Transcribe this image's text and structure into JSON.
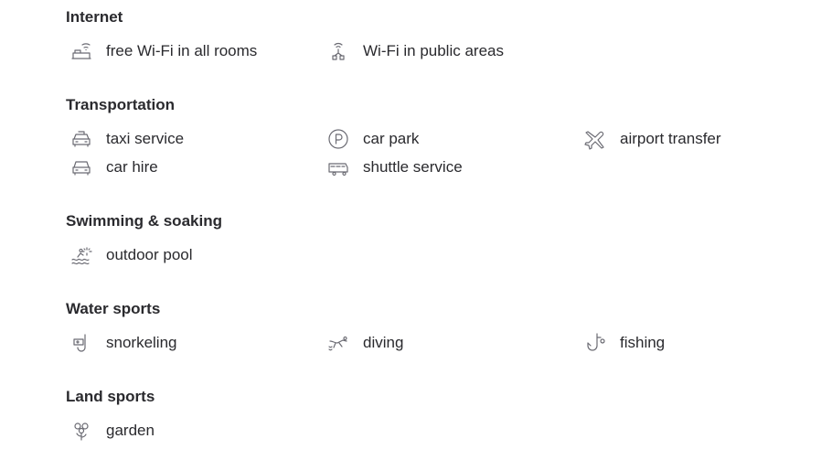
{
  "sections": [
    {
      "title": "Internet",
      "items": [
        {
          "label": "free Wi-Fi in all rooms",
          "icon": "wifi-bed-icon"
        },
        {
          "label": "Wi-Fi in public areas",
          "icon": "wifi-router-icon"
        }
      ]
    },
    {
      "title": "Transportation",
      "items": [
        {
          "label": "taxi service",
          "icon": "taxi-icon"
        },
        {
          "label": "car park",
          "icon": "parking-icon"
        },
        {
          "label": "airport transfer",
          "icon": "airplane-icon"
        },
        {
          "label": "car hire",
          "icon": "car-icon"
        },
        {
          "label": "shuttle service",
          "icon": "shuttle-bus-icon"
        }
      ]
    },
    {
      "title": "Swimming & soaking",
      "items": [
        {
          "label": "outdoor pool",
          "icon": "outdoor-pool-icon"
        }
      ]
    },
    {
      "title": "Water sports",
      "items": [
        {
          "label": "snorkeling",
          "icon": "snorkel-mask-icon"
        },
        {
          "label": "diving",
          "icon": "diver-icon"
        },
        {
          "label": "fishing",
          "icon": "fishing-hook-icon"
        }
      ]
    },
    {
      "title": "Land sports",
      "items": [
        {
          "label": "garden",
          "icon": "flower-icon"
        }
      ]
    }
  ]
}
